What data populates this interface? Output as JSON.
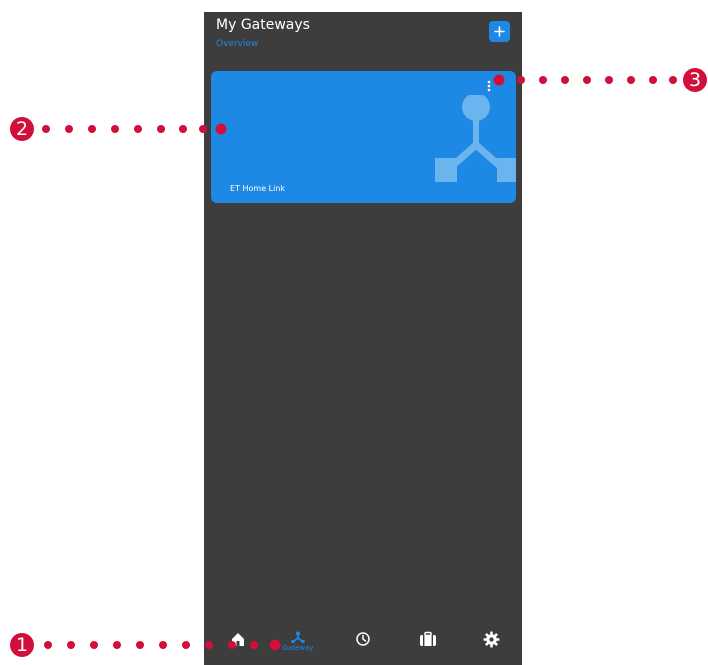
{
  "header": {
    "title": "My Gateways",
    "subtitle": "Overview",
    "add_label": "+"
  },
  "gateways": [
    {
      "name": "ET Home Link"
    }
  ],
  "bottom_nav": {
    "items": [
      {
        "id": "home",
        "icon": "home-icon",
        "label": ""
      },
      {
        "id": "gateway",
        "icon": "gateway-icon",
        "label": "Gateway",
        "active": true
      },
      {
        "id": "clock",
        "icon": "clock-icon",
        "label": ""
      },
      {
        "id": "briefcase",
        "icon": "briefcase-icon",
        "label": ""
      },
      {
        "id": "settings",
        "icon": "gear-icon",
        "label": ""
      }
    ]
  },
  "callouts": [
    {
      "number": "1"
    },
    {
      "number": "2"
    },
    {
      "number": "3"
    }
  ],
  "colors": {
    "accent": "#1e88e5",
    "background": "#3d3d3d",
    "callout": "#d0103a"
  }
}
